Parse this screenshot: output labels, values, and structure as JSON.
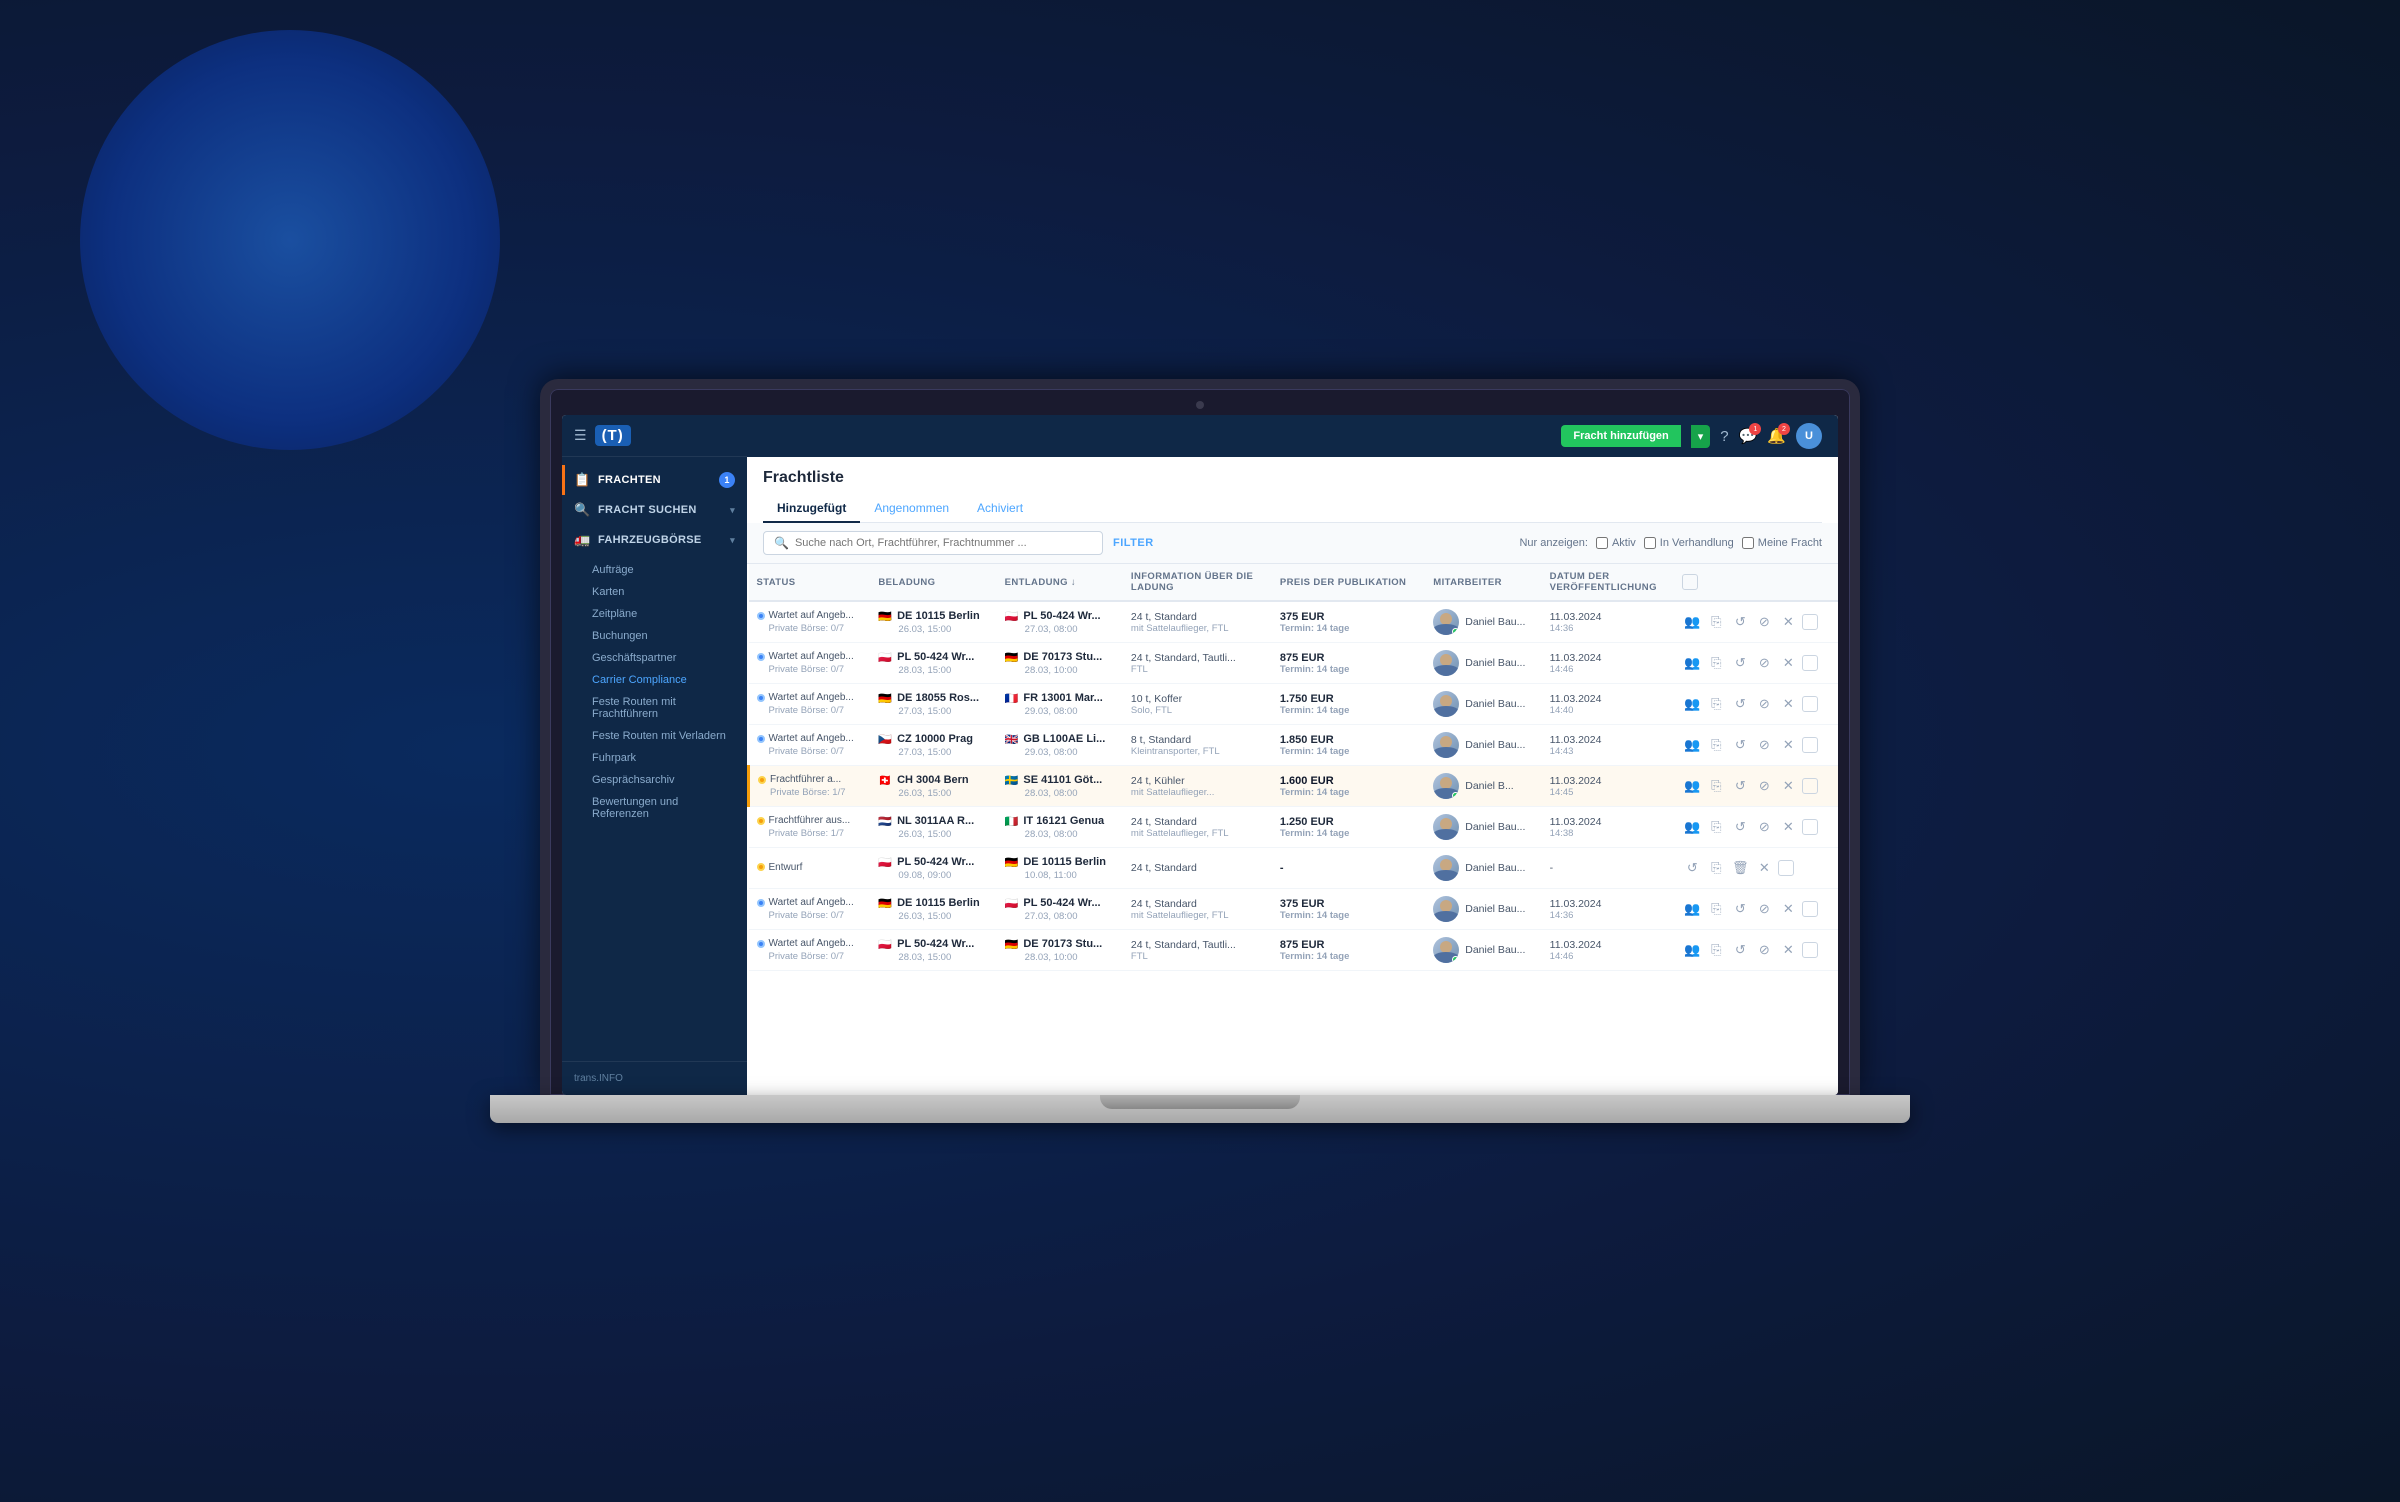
{
  "background": {
    "circle_color": "#1a4fa0"
  },
  "topbar": {
    "add_button_label": "Fracht hinzufügen",
    "add_button_arrow": "▾"
  },
  "sidebar": {
    "logo": "(T)",
    "hamburger": "☰",
    "sections": [
      {
        "id": "frachten",
        "label": "FRACHTEN",
        "icon": "📋",
        "badge": "1",
        "active": true
      },
      {
        "id": "fracht-suchen",
        "label": "FRACHT SUCHEN",
        "icon": "🔍",
        "has_arrow": true
      },
      {
        "id": "fahrzeugborse",
        "label": "FAHRZEUGBÖRSE",
        "icon": "🚛",
        "has_arrow": true
      }
    ],
    "sub_items": [
      "Aufträge",
      "Karten",
      "Zeitpläne",
      "Buchungen",
      "Geschäftspartner",
      "Carrier Compliance",
      "Feste Routen mit Frachtführern",
      "Feste Routen mit Verladern",
      "Fuhrpark",
      "Gesprächsarchiv",
      "Bewertungen und Referenzen"
    ],
    "bottom_item": "trans.INFO"
  },
  "frachtliste": {
    "title": "Frachtliste",
    "tabs": [
      {
        "label": "Hinzugefügt",
        "active": true
      },
      {
        "label": "Angenommen",
        "active": false
      },
      {
        "label": "Achiviert",
        "active": false
      }
    ],
    "filter": {
      "placeholder": "Suche nach Ort, Frachtführer, Frachtnummer ...",
      "filter_label": "FILTER",
      "show_label": "Nur anzeigen:",
      "checkboxes": [
        "Aktiv",
        "In Verhandlung",
        "Meine Fracht"
      ]
    }
  },
  "table": {
    "headers": [
      "STATUS",
      "BELADUNG",
      "ENTLADUNG ↓",
      "INFORMATION ÜBER DIE LADUNG",
      "PREIS DER PUBLIKATION",
      "MITARBEITER",
      "DATUM DER VERÖFFENTLICHUNG",
      ""
    ],
    "rows": [
      {
        "id": 1,
        "status_label": "Wartet auf Angeb...",
        "status_sub": "Private Börse: 0/7",
        "status_type": "blue",
        "load_flag": "de",
        "load_city": "DE 10115 Berlin",
        "load_date": "26.03, 15:00",
        "unload_flag": "pl",
        "unload_city": "PL 50-424 Wr...",
        "unload_date": "27.03, 08:00",
        "info": "24 t, Standard",
        "info2": "mit Sattelauflieger, FTL",
        "price": "375 EUR",
        "price_sub": "Termin: 14 tage",
        "price_bold": false,
        "mitarbeiter": "Daniel Bau...",
        "online": true,
        "date": "11.03.2024",
        "time": "14:36",
        "highlighted": false
      },
      {
        "id": 2,
        "status_label": "Wartet auf Angeb...",
        "status_sub": "Private Börse: 0/7",
        "status_type": "blue",
        "load_flag": "pl",
        "load_city": "PL 50-424 Wr...",
        "load_date": "28.03, 15:00",
        "unload_flag": "de",
        "unload_city": "DE 70173 Stu...",
        "unload_date": "28.03, 10:00",
        "info": "24 t, Standard, Tautli...",
        "info2": "FTL",
        "price": "875 EUR",
        "price_sub": "Termin: 14 tage",
        "price_bold": false,
        "mitarbeiter": "Daniel Bau...",
        "online": false,
        "date": "11.03.2024",
        "time": "14:46",
        "highlighted": false
      },
      {
        "id": 3,
        "status_label": "Wartet auf Angeb...",
        "status_sub": "Private Börse: 0/7",
        "status_type": "blue",
        "load_flag": "de",
        "load_city": "DE 18055 Ros...",
        "load_date": "27.03, 15:00",
        "unload_flag": "fr",
        "unload_city": "FR 13001 Mar...",
        "unload_date": "29.03, 08:00",
        "info": "10 t, Koffer",
        "info2": "Solo, FTL",
        "price": "1.750 EUR",
        "price_sub": "Termin: 14 tage",
        "price_bold": false,
        "mitarbeiter": "Daniel Bau...",
        "online": false,
        "date": "11.03.2024",
        "time": "14:40",
        "highlighted": false
      },
      {
        "id": 4,
        "status_label": "Wartet auf Angeb...",
        "status_sub": "Private Börse: 0/7",
        "status_type": "blue",
        "load_flag": "cz",
        "load_city": "CZ 10000 Prag",
        "load_date": "27.03, 15:00",
        "unload_flag": "gb",
        "unload_city": "GB L100AE Li...",
        "unload_date": "29.03, 08:00",
        "info": "8 t, Standard",
        "info2": "Kleintransporter, FTL",
        "price": "1.850 EUR",
        "price_sub": "Termin: 14 tage",
        "price_bold": false,
        "mitarbeiter": "Daniel Bau...",
        "online": false,
        "date": "11.03.2024",
        "time": "14:43",
        "highlighted": false
      },
      {
        "id": 5,
        "status_label": "Frachtführer a...",
        "status_sub": "Private Börse: 1/7",
        "status_type": "yellow",
        "load_flag": "ch",
        "load_city": "CH 3004 Bern",
        "load_date": "26.03, 15:00",
        "unload_flag": "se",
        "unload_city": "SE 41101 Göt...",
        "unload_date": "28.03, 08:00",
        "info": "24 t, Kühler",
        "info2": "mit Sattelauflieger...",
        "price": "1.600 EUR",
        "price_sub": "Termin: 14 tage",
        "price_bold": true,
        "mitarbeiter": "Daniel B...",
        "online": true,
        "date": "11.03.2024",
        "time": "14:45",
        "highlighted": true
      },
      {
        "id": 6,
        "status_label": "Frachtführer aus...",
        "status_sub": "Private Börse: 1/7",
        "status_type": "yellow",
        "load_flag": "nl",
        "load_city": "NL 3011AA R...",
        "load_date": "26.03, 15:00",
        "unload_flag": "it",
        "unload_city": "IT 16121 Genua",
        "unload_date": "28.03, 08:00",
        "info": "24 t, Standard",
        "info2": "mit Sattelauflieger, FTL",
        "price": "1.250 EUR",
        "price_sub": "Termin: 14 tage",
        "price_bold": false,
        "mitarbeiter": "Daniel Bau...",
        "online": false,
        "date": "11.03.2024",
        "time": "14:38",
        "highlighted": false
      },
      {
        "id": 7,
        "status_label": "Entwurf",
        "status_sub": "",
        "status_type": "yellow",
        "load_flag": "pl",
        "load_city": "PL 50-424 Wr...",
        "load_date": "09.08, 09:00",
        "unload_flag": "de",
        "unload_city": "DE 10115 Berlin",
        "unload_date": "10.08, 11:00",
        "info": "24 t, Standard",
        "info2": "",
        "price": "-",
        "price_sub": "",
        "price_bold": false,
        "mitarbeiter": "Daniel Bau...",
        "online": false,
        "date": "-",
        "time": "",
        "highlighted": false,
        "is_draft": true
      },
      {
        "id": 8,
        "status_label": "Wartet auf Angeb...",
        "status_sub": "Private Börse: 0/7",
        "status_type": "blue",
        "load_flag": "de",
        "load_city": "DE 10115 Berlin",
        "load_date": "26.03, 15:00",
        "unload_flag": "pl",
        "unload_city": "PL 50-424 Wr...",
        "unload_date": "27.03, 08:00",
        "info": "24 t, Standard",
        "info2": "mit Sattelauflieger, FTL",
        "price": "375 EUR",
        "price_sub": "Termin: 14 tage",
        "price_bold": false,
        "mitarbeiter": "Daniel Bau...",
        "online": false,
        "date": "11.03.2024",
        "time": "14:36",
        "highlighted": false
      },
      {
        "id": 9,
        "status_label": "Wartet auf Angeb...",
        "status_sub": "Private Börse: 0/7",
        "status_type": "blue",
        "load_flag": "pl",
        "load_city": "PL 50-424 Wr...",
        "load_date": "28.03, 15:00",
        "unload_flag": "de",
        "unload_city": "DE 70173 Stu...",
        "unload_date": "28.03, 10:00",
        "info": "24 t, Standard, Tautli...",
        "info2": "FTL",
        "price": "875 EUR",
        "price_sub": "Termin: 14 tage",
        "price_bold": false,
        "mitarbeiter": "Daniel Bau...",
        "online": true,
        "date": "11.03.2024",
        "time": "14:46",
        "highlighted": false
      }
    ]
  }
}
